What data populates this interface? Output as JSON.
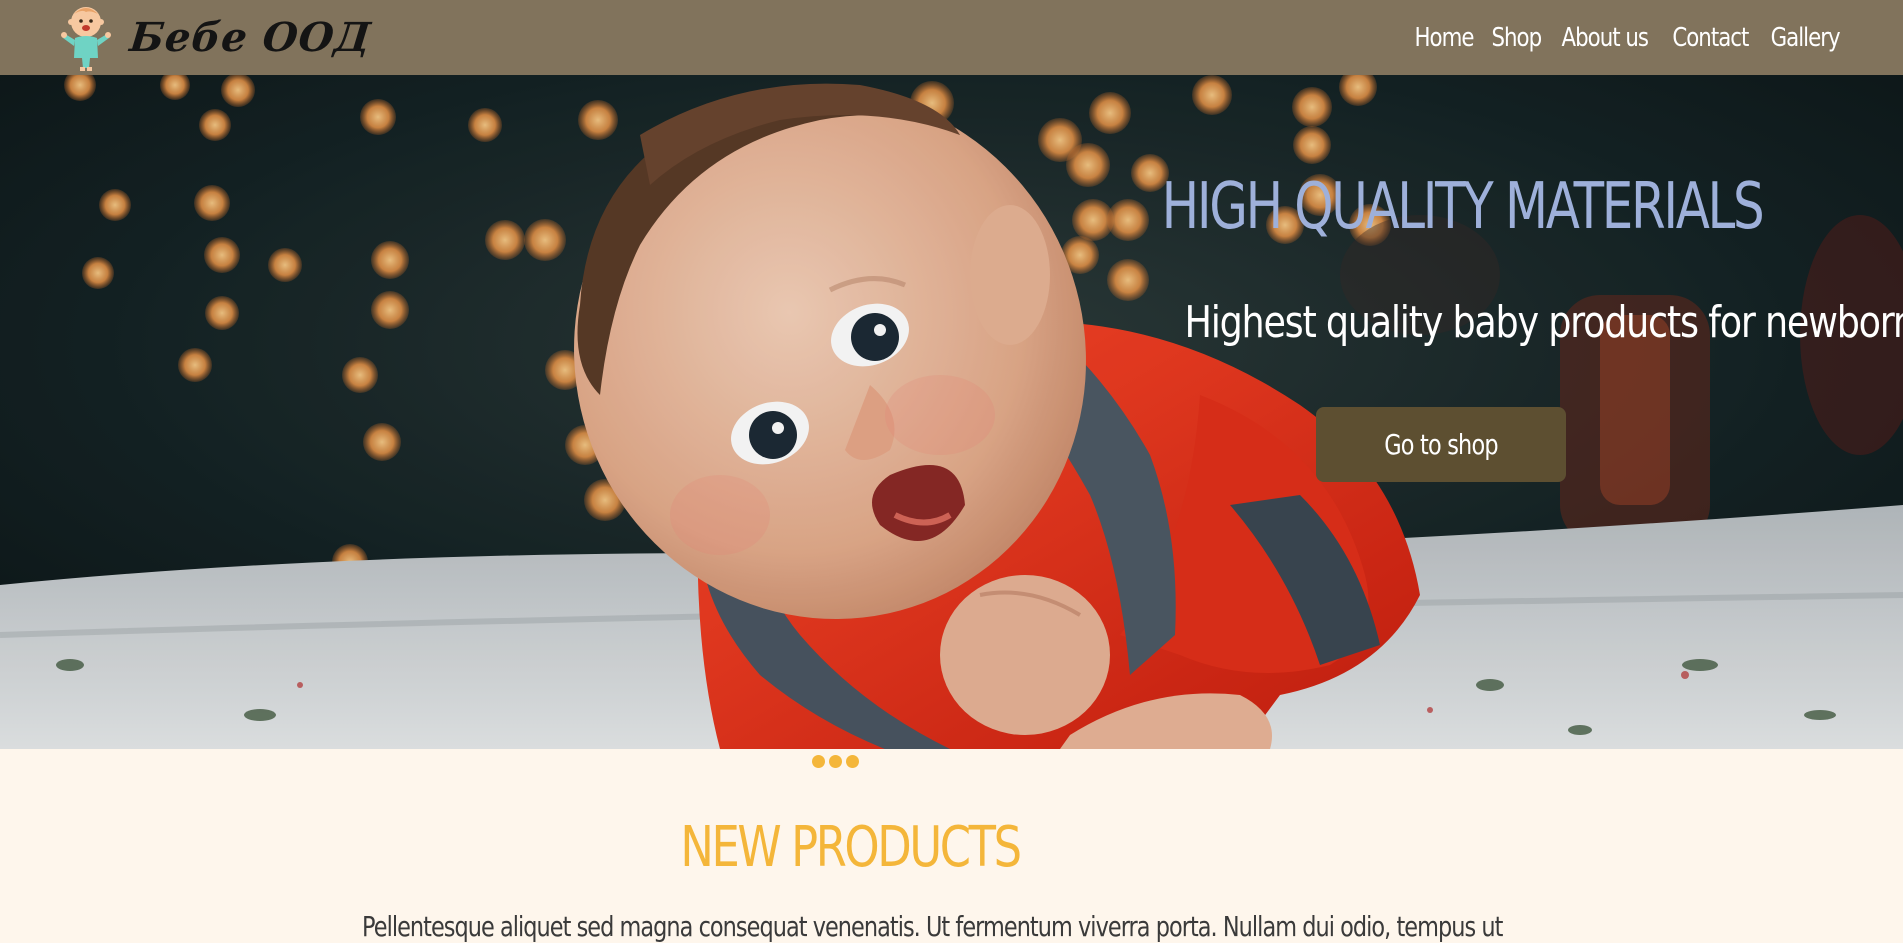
{
  "header": {
    "brand_name": "Бебе ООД",
    "nav": [
      "Home",
      "Shop",
      "About us",
      "Contact",
      "Gallery"
    ]
  },
  "hero": {
    "title": "HIGH QUALITY MATERIALS",
    "subtitle": "Highest quality baby products for newborn, infants",
    "button_label": "Go to shop",
    "image": "baby-photo"
  },
  "carousel": {
    "dot_count": 3
  },
  "new_products": {
    "title": "NEW PRODUCTS",
    "text": "Pellentesque aliquet sed magna consequat venenatis. Ut fermentum viverra porta. Nullam dui odio, tempus ut"
  },
  "colors": {
    "header_bg": "#81735c",
    "accent_yellow": "#f4b63a",
    "hero_title": "#9eb0da",
    "button_bg": "#5d4f31",
    "page_bg": "#fef6ec"
  }
}
